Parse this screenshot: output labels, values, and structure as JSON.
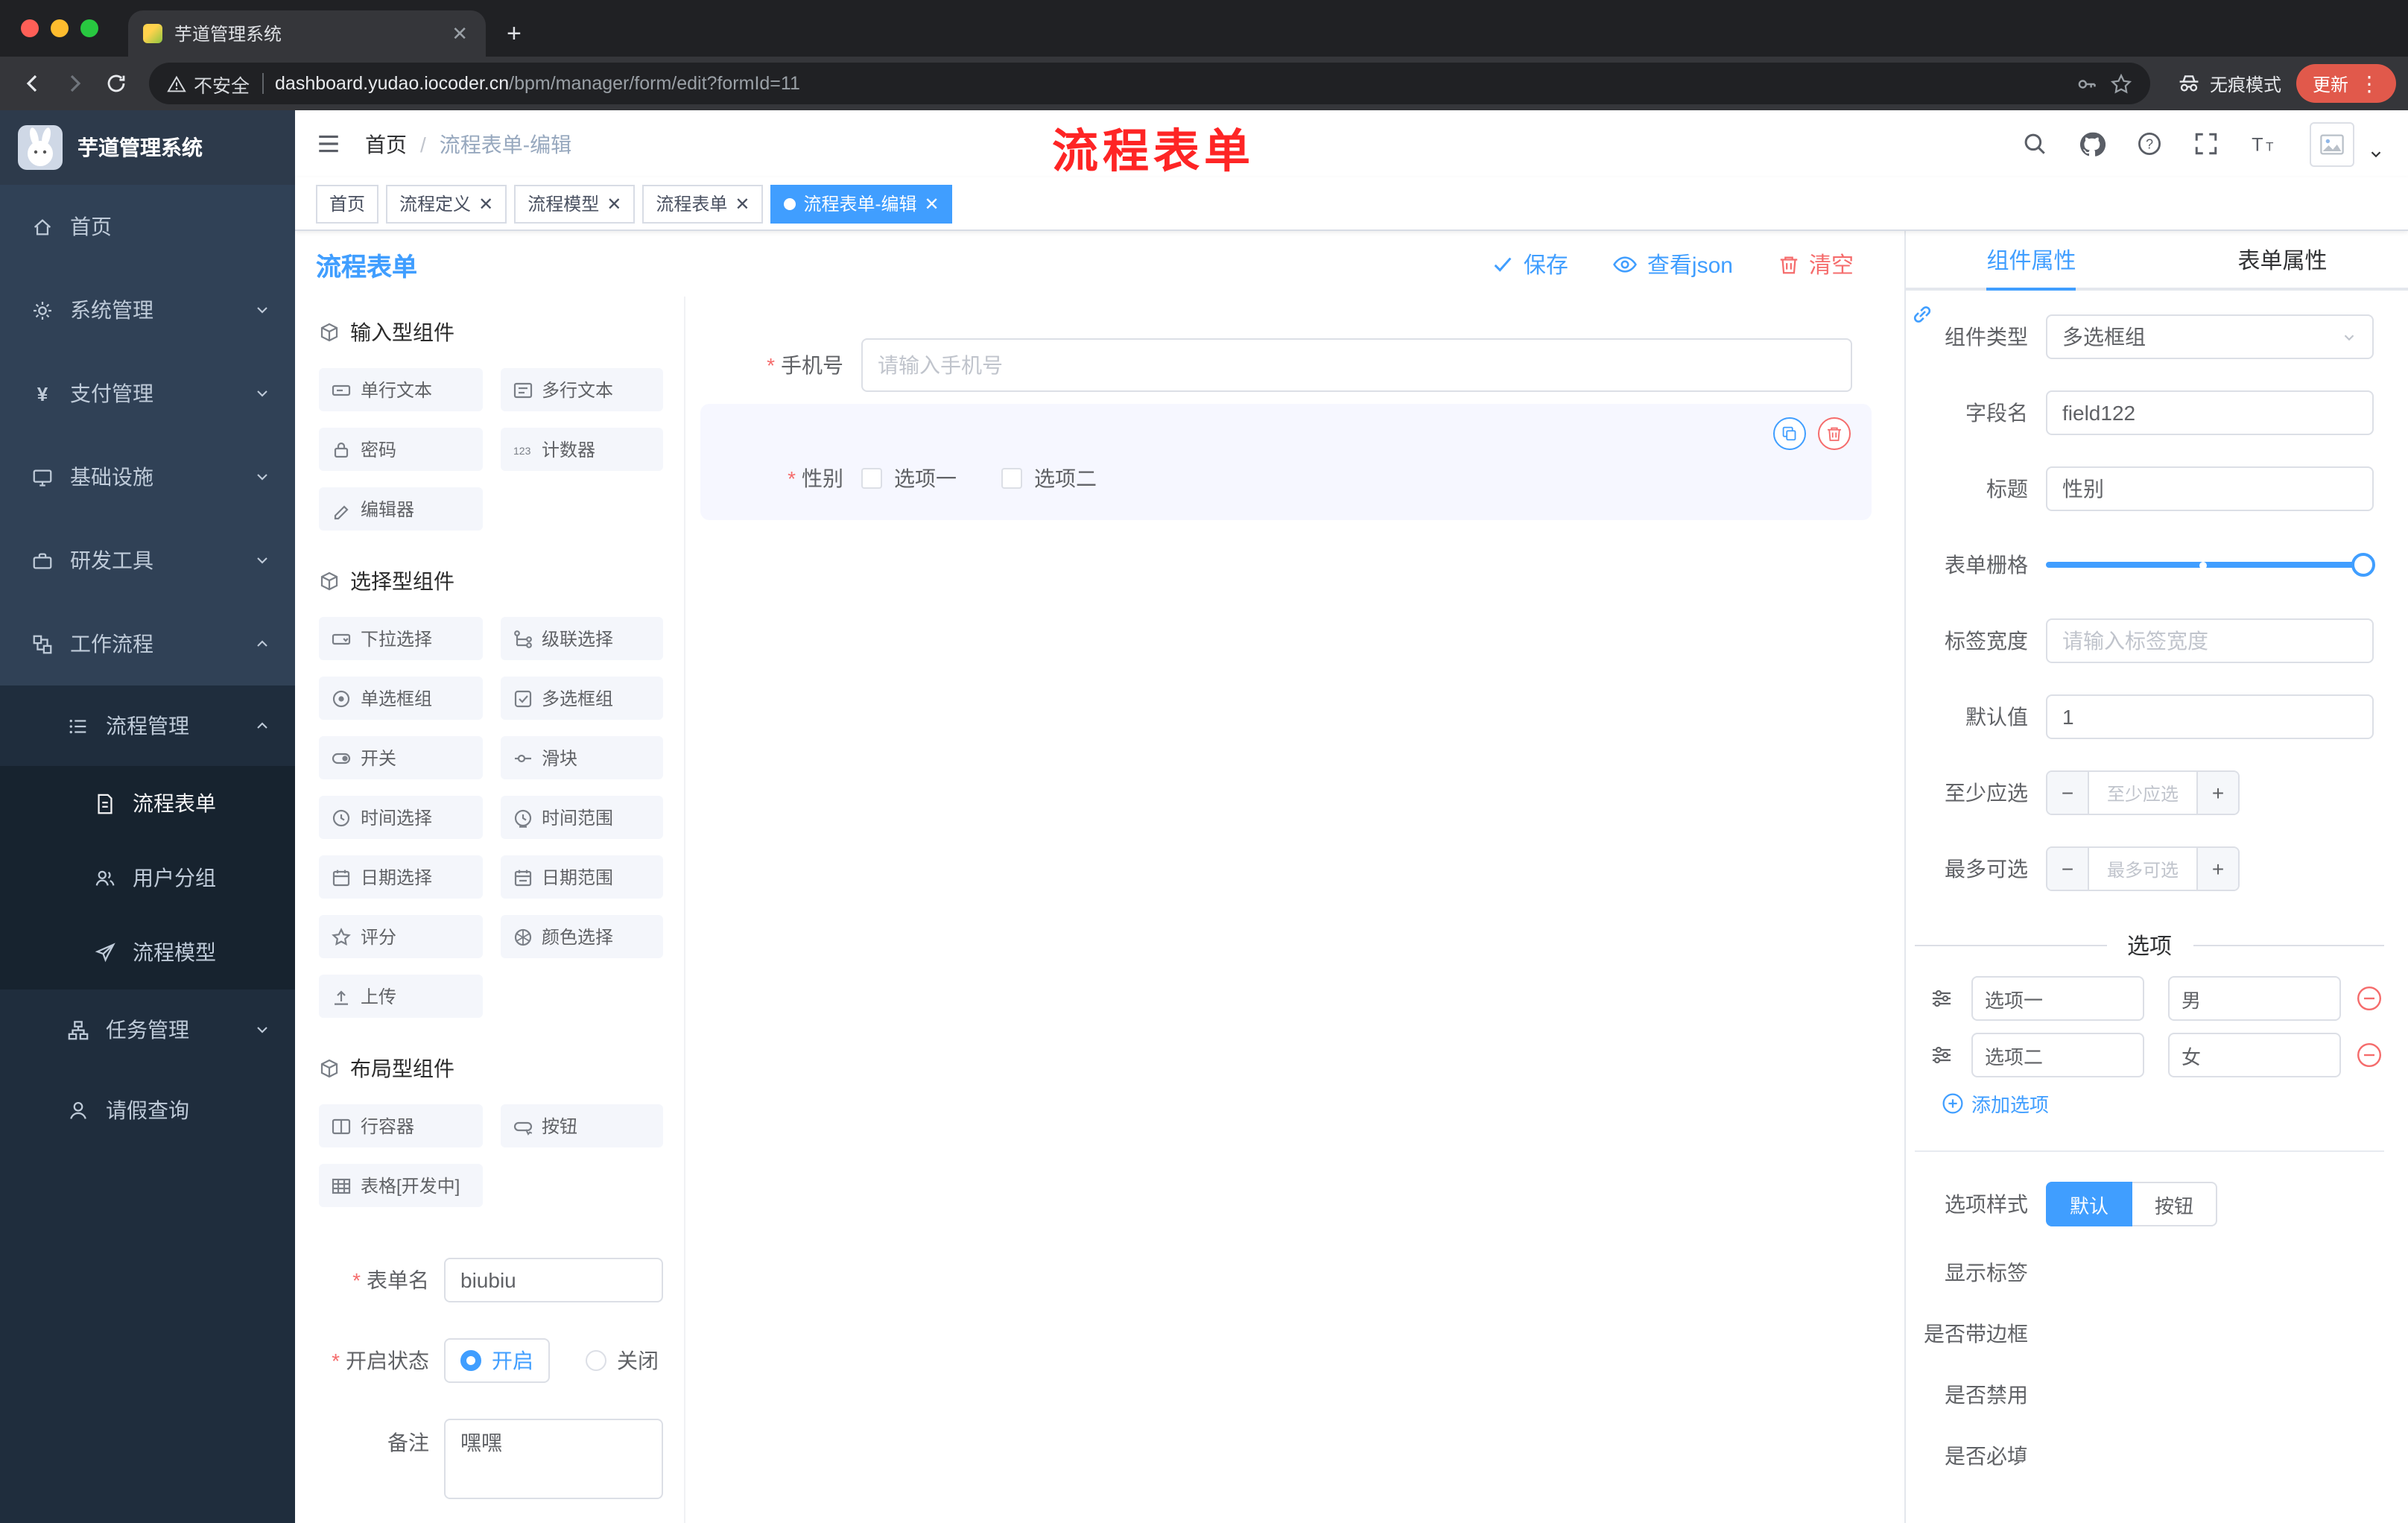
{
  "colors": {
    "accent": "#409eff",
    "danger": "#f56c6c",
    "annotation_red": "#fe2525",
    "sidebar_bg": "#304156",
    "tag_active": "#409eff",
    "update_button": "#e1594b"
  },
  "browser": {
    "tab_title": "芋道管理系统",
    "security_label": "不安全",
    "url_host": "dashboard.yudao.iocoder.cn",
    "url_path": "/bpm/manager/form/edit?formId=11",
    "incognito_label": "无痕模式",
    "update_label": "更新"
  },
  "annotation": {
    "text": "流程表单"
  },
  "sidebar": {
    "logo_title": "芋道管理系统",
    "items": [
      {
        "label": "首页"
      },
      {
        "label": "系统管理"
      },
      {
        "label": "支付管理"
      },
      {
        "label": "基础设施"
      },
      {
        "label": "研发工具"
      },
      {
        "label": "工作流程"
      },
      {
        "label": "流程管理"
      },
      {
        "label": "流程表单"
      },
      {
        "label": "用户分组"
      },
      {
        "label": "流程模型"
      },
      {
        "label": "任务管理"
      },
      {
        "label": "请假查询"
      }
    ]
  },
  "header": {
    "breadcrumb_home": "首页",
    "breadcrumb_current": "流程表单-编辑"
  },
  "tags": [
    {
      "label": "首页"
    },
    {
      "label": "流程定义"
    },
    {
      "label": "流程模型"
    },
    {
      "label": "流程表单"
    },
    {
      "label": "流程表单-编辑"
    }
  ],
  "designer": {
    "title": "流程表单",
    "actions": {
      "save": "保存",
      "view_json": "查看json",
      "clear": "清空"
    }
  },
  "palette": {
    "sections": [
      {
        "title": "输入型组件",
        "items": [
          "单行文本",
          "多行文本",
          "密码",
          "计数器",
          "编辑器"
        ]
      },
      {
        "title": "选择型组件",
        "items": [
          "下拉选择",
          "级联选择",
          "单选框组",
          "多选框组",
          "开关",
          "滑块",
          "时间选择",
          "时间范围",
          "日期选择",
          "日期范围",
          "评分",
          "颜色选择",
          "上传"
        ]
      },
      {
        "title": "布局型组件",
        "items": [
          "行容器",
          "按钮",
          "表格[开发中]"
        ]
      }
    ],
    "form": {
      "name_label": "表单名",
      "name_value": "biubiu",
      "status_label": "开启状态",
      "status_on": "开启",
      "status_off": "关闭",
      "remark_label": "备注",
      "remark_value": "嘿嘿"
    }
  },
  "canvas": {
    "phone": {
      "label": "手机号",
      "placeholder": "请输入手机号"
    },
    "gender": {
      "label": "性别",
      "options": [
        "选项一",
        "选项二"
      ]
    }
  },
  "props": {
    "tabs": [
      "组件属性",
      "表单属性"
    ],
    "rows": {
      "component_type": {
        "label": "组件类型",
        "value": "多选框组"
      },
      "field_name": {
        "label": "字段名",
        "value": "field122"
      },
      "title": {
        "label": "标题",
        "value": "性别"
      },
      "grid": {
        "label": "表单栅格"
      },
      "label_width": {
        "label": "标签宽度",
        "placeholder": "请输入标签宽度"
      },
      "default_value": {
        "label": "默认值",
        "value": "1"
      },
      "min_select": {
        "label": "至少应选",
        "placeholder": "至少应选"
      },
      "max_select": {
        "label": "最多可选",
        "placeholder": "最多可选"
      }
    },
    "options": {
      "divider": "选项",
      "items": [
        {
          "label": "选项一",
          "value": "男"
        },
        {
          "label": "选项二",
          "value": "女"
        }
      ],
      "add_label": "添加选项"
    },
    "style": {
      "label": "选项样式",
      "choices": [
        "默认",
        "按钮"
      ]
    },
    "switches": [
      {
        "label": "显示标签"
      },
      {
        "label": "是否带边框"
      },
      {
        "label": "是否禁用"
      },
      {
        "label": "是否必填"
      }
    ]
  }
}
